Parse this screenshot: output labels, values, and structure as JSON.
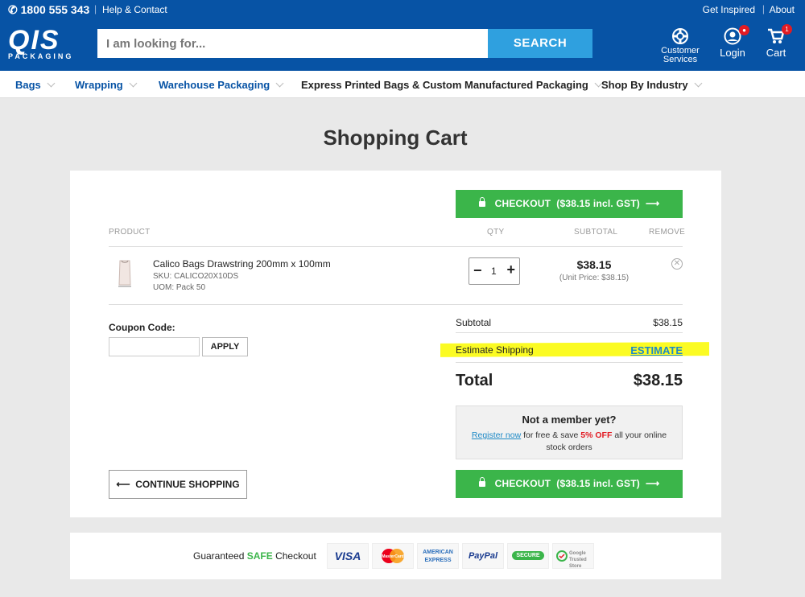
{
  "topbar": {
    "phone": "1800 555 343",
    "help": "Help & Contact",
    "inspired": "Get Inspired",
    "about": "About"
  },
  "logo": {
    "main": "QIS",
    "sub": "PACKAGING"
  },
  "search": {
    "placeholder": "I am looking for...",
    "button": "SEARCH"
  },
  "header": {
    "customer_label1": "Customer",
    "customer_label2": "Services",
    "login_label": "Login",
    "cart_label": "Cart",
    "cart_count": "1"
  },
  "nav": [
    "Bags",
    "Wrapping",
    "Warehouse Packaging",
    "Express Printed Bags & Custom Manufactured Packaging",
    "Shop By Industry"
  ],
  "page": {
    "title": "Shopping Cart"
  },
  "cart": {
    "checkout_label": "CHECKOUT",
    "checkout_amount": "($38.15 incl. GST)",
    "headers": {
      "product": "PRODUCT",
      "qty": "QTY",
      "subtotal": "SUBTOTAL",
      "remove": "REMOVE"
    },
    "item": {
      "name": "Calico Bags Drawstring 200mm x 100mm",
      "sku": "SKU: CALICO20X10DS",
      "uom": "UOM: Pack 50",
      "qty": "1",
      "price": "$38.15",
      "unit_price": "(Unit Price: $38.15)"
    },
    "coupon_label": "Coupon Code:",
    "apply": "APPLY",
    "subtotal_label": "Subtotal",
    "subtotal_value": "$38.15",
    "shipping_label": "Estimate Shipping",
    "estimate_link": "ESTIMATE",
    "total_label": "Total",
    "total_value": "$38.15",
    "member_heading": "Not a member yet?",
    "member_register": "Register now",
    "member_text1": "for free & save",
    "member_off": "5% OFF",
    "member_text2": "all your online stock orders",
    "continue": "CONTINUE SHOPPING"
  },
  "safe": {
    "pre": "Guaranteed",
    "safe": "SAFE",
    "post": "Checkout",
    "methods": [
      "VISA",
      "MasterCard",
      "AMERICAN EXPRESS",
      "PayPal",
      "SECURE",
      "Google Trusted Store"
    ]
  },
  "colors": {
    "brand_blue": "#0753a5",
    "search_blue": "#2fa0df",
    "checkout_green": "#3bb54a",
    "highlight_yellow": "#fbfb23",
    "badge_red": "#e21b23"
  }
}
